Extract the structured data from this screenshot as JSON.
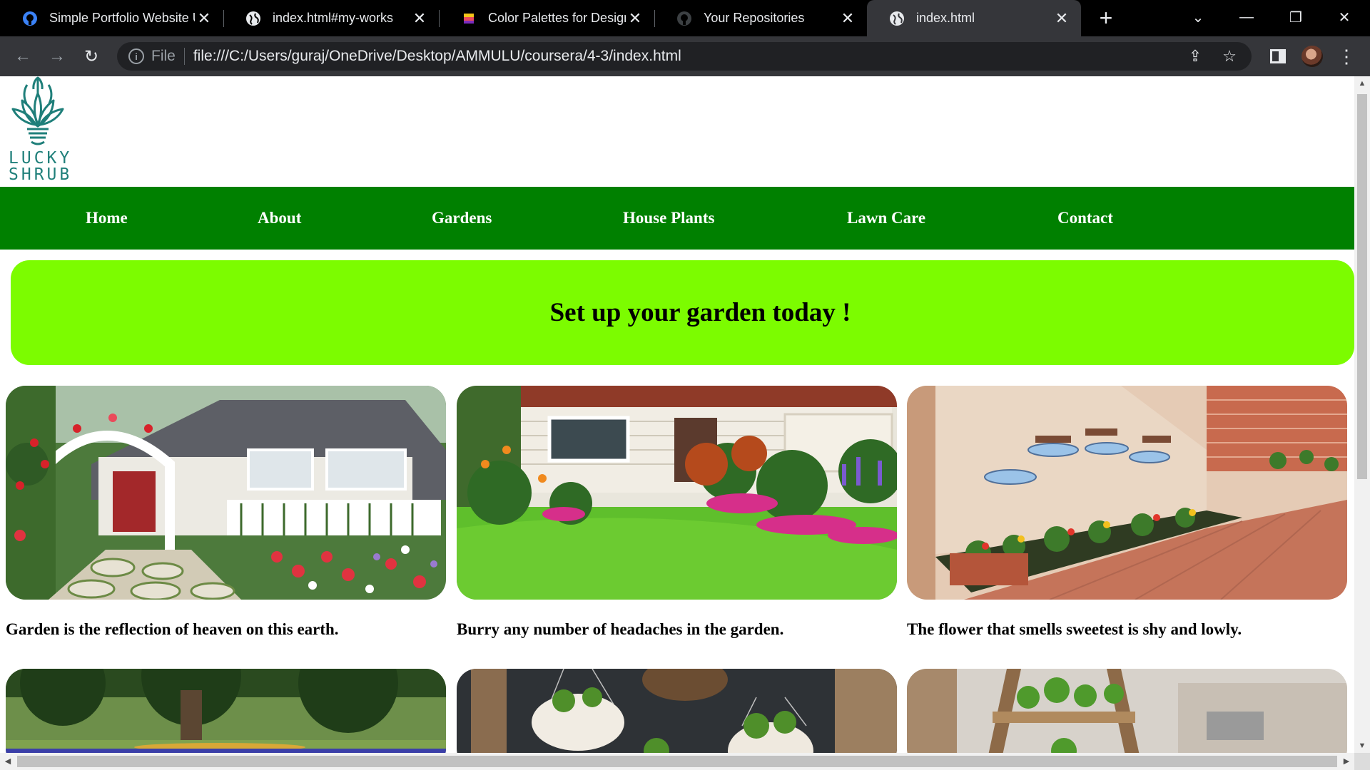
{
  "browser": {
    "tabs": [
      {
        "title": "Simple Portfolio Website U",
        "icon": "github-icon"
      },
      {
        "title": "index.html#my-works",
        "icon": "globe-icon"
      },
      {
        "title": "Color Palettes for Designers",
        "icon": "palette-icon"
      },
      {
        "title": "Your Repositories",
        "icon": "github-icon"
      },
      {
        "title": "index.html",
        "icon": "globe-icon",
        "active": true
      }
    ],
    "address": {
      "scheme": "File",
      "url": "file:///C:/Users/guraj/OneDrive/Desktop/AMMULU/coursera/4-3/index.html"
    }
  },
  "site": {
    "logo_line1": "LUCKY",
    "logo_line2": "SHRUB",
    "nav": [
      "Home",
      "About",
      "Gardens",
      "House Plants",
      "Lawn Care",
      "Contact"
    ],
    "banner_title": "Set up your garden today !",
    "cards": [
      {
        "caption": "Garden is the reflection of heaven on this earth.",
        "image": "cottage garden with white arbor and picket fence"
      },
      {
        "caption": "Burry any number of headaches in the garden.",
        "image": "house with green lawn and flower beds"
      },
      {
        "caption": "The flower that smells sweetest is shy and lowly.",
        "image": "terrace garden with hanging planters"
      },
      {
        "caption": "",
        "image": "park with large trees"
      },
      {
        "caption": "",
        "image": "hanging coconut shell planters"
      },
      {
        "caption": "",
        "image": "wooden ladder plant stand"
      }
    ]
  },
  "colors": {
    "nav_bg": "#008000",
    "banner_bg": "#7cfc00",
    "logo_teal": "#1f7f7a"
  }
}
